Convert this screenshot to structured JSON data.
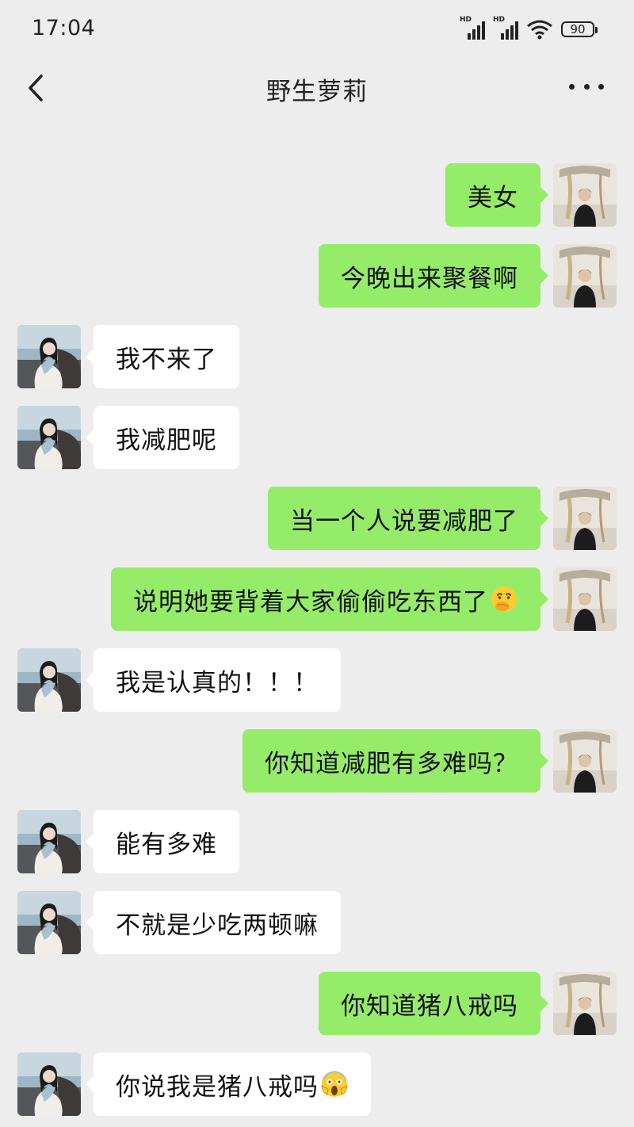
{
  "status_bar": {
    "time": "17:04",
    "battery": "90",
    "signal_label": "HD",
    "icons": [
      "signal-hd-icon",
      "signal-hd-icon",
      "wifi-icon",
      "battery-icon"
    ]
  },
  "header": {
    "title": "野生萝莉",
    "back_icon": "chevron-left-icon",
    "more_icon": "more-dots-icon"
  },
  "colors": {
    "background": "#ededed",
    "outgoing_bubble": "#95ec69",
    "incoming_bubble": "#ffffff"
  },
  "messages": [
    {
      "from": "me",
      "text": "美女"
    },
    {
      "from": "me",
      "text": "今晚出来聚餐啊"
    },
    {
      "from": "contact",
      "text": "我不来了"
    },
    {
      "from": "contact",
      "text": "我减肥呢"
    },
    {
      "from": "me",
      "text": "当一个人说要减肥了"
    },
    {
      "from": "me",
      "text": "说明她要背着大家偷偷吃东西了",
      "emoji": "thinking-hand-over-mouth-emoji"
    },
    {
      "from": "contact",
      "text": "我是认真的！！！"
    },
    {
      "from": "me",
      "text": "你知道减肥有多难吗？"
    },
    {
      "from": "contact",
      "text": "能有多难"
    },
    {
      "from": "contact",
      "text": "不就是少吃两顿嘛"
    },
    {
      "from": "me",
      "text": "你知道猪八戒吗"
    },
    {
      "from": "contact",
      "text": "你说我是猪八戒吗",
      "emoji": "face-screaming-in-fear-emoji"
    }
  ]
}
